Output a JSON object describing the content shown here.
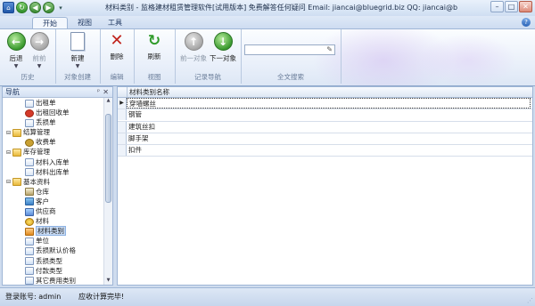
{
  "window": {
    "title": "材料类别 - 监格建材租赁管理软件[试用版本] 免费解答任何疑问 Email: jiancai@bluegrid.biz  QQ: jiancai@bluegri..."
  },
  "tabs": [
    {
      "label": "开始",
      "active": true
    },
    {
      "label": "视图",
      "active": false
    },
    {
      "label": "工具",
      "active": false
    }
  ],
  "ribbon": {
    "groups": [
      {
        "label": "历史",
        "buttons": [
          {
            "label": "后退",
            "icon": "back-arrow-icon",
            "dropdown": true
          },
          {
            "label": "前前",
            "icon": "forward-arrow-icon",
            "disabled": true
          }
        ]
      },
      {
        "label": "对象创建",
        "buttons": [
          {
            "label": "新建",
            "icon": "new-document-icon",
            "dropdown": true
          }
        ]
      },
      {
        "label": "编辑",
        "buttons": [
          {
            "label": "删除",
            "icon": "delete-x-icon"
          }
        ]
      },
      {
        "label": "视图",
        "buttons": [
          {
            "label": "刷新",
            "icon": "refresh-icon"
          }
        ]
      },
      {
        "label": "记录导航",
        "buttons": [
          {
            "label": "前一对象",
            "icon": "up-arrow-icon",
            "disabled": true
          },
          {
            "label": "下一对象",
            "icon": "down-arrow-icon"
          }
        ]
      },
      {
        "label": "全文搜索",
        "search_value": ""
      }
    ]
  },
  "nav": {
    "title": "导航",
    "tree": [
      {
        "label": "出租单",
        "level": 2,
        "icon": "doc-icon"
      },
      {
        "label": "出租回收单",
        "level": 2,
        "icon": "warn-icon"
      },
      {
        "label": "丢损单",
        "level": 2,
        "icon": "doc-icon"
      },
      {
        "label": "结算管理",
        "level": 1,
        "icon": "folder-icon",
        "expanded": true
      },
      {
        "label": "收费单",
        "level": 2,
        "icon": "money-icon"
      },
      {
        "label": "库存管理",
        "level": 1,
        "icon": "folder-icon",
        "expanded": true
      },
      {
        "label": "材料入库单",
        "level": 2,
        "icon": "doc-icon"
      },
      {
        "label": "材料出库单",
        "level": 2,
        "icon": "doc-icon"
      },
      {
        "label": "基本资料",
        "level": 1,
        "icon": "folder-icon",
        "expanded": true
      },
      {
        "label": "仓库",
        "level": 2,
        "icon": "house-icon"
      },
      {
        "label": "客户",
        "level": 2,
        "icon": "user-icon"
      },
      {
        "label": "供应商",
        "level": 2,
        "icon": "people-icon"
      },
      {
        "label": "材料",
        "level": 2,
        "icon": "gold-icon"
      },
      {
        "label": "材料类别",
        "level": 2,
        "icon": "tag-icon",
        "selected": true
      },
      {
        "label": "单位",
        "level": 2,
        "icon": "list-icon"
      },
      {
        "label": "丢损默认价格",
        "level": 2,
        "icon": "list-icon"
      },
      {
        "label": "丢损类型",
        "level": 2,
        "icon": "list-icon"
      },
      {
        "label": "付款类型",
        "level": 2,
        "icon": "list-icon"
      },
      {
        "label": "其它费用类别",
        "level": 2,
        "icon": "list-icon"
      }
    ]
  },
  "grid": {
    "column": "材料类别名称",
    "rows": [
      "穿墙螺丝",
      "钢管",
      "建筑丝扣",
      "脚手架",
      "扣件"
    ],
    "focused_row": 0
  },
  "status": {
    "account": "登录账号: admin",
    "message": "应收计算完毕!"
  }
}
